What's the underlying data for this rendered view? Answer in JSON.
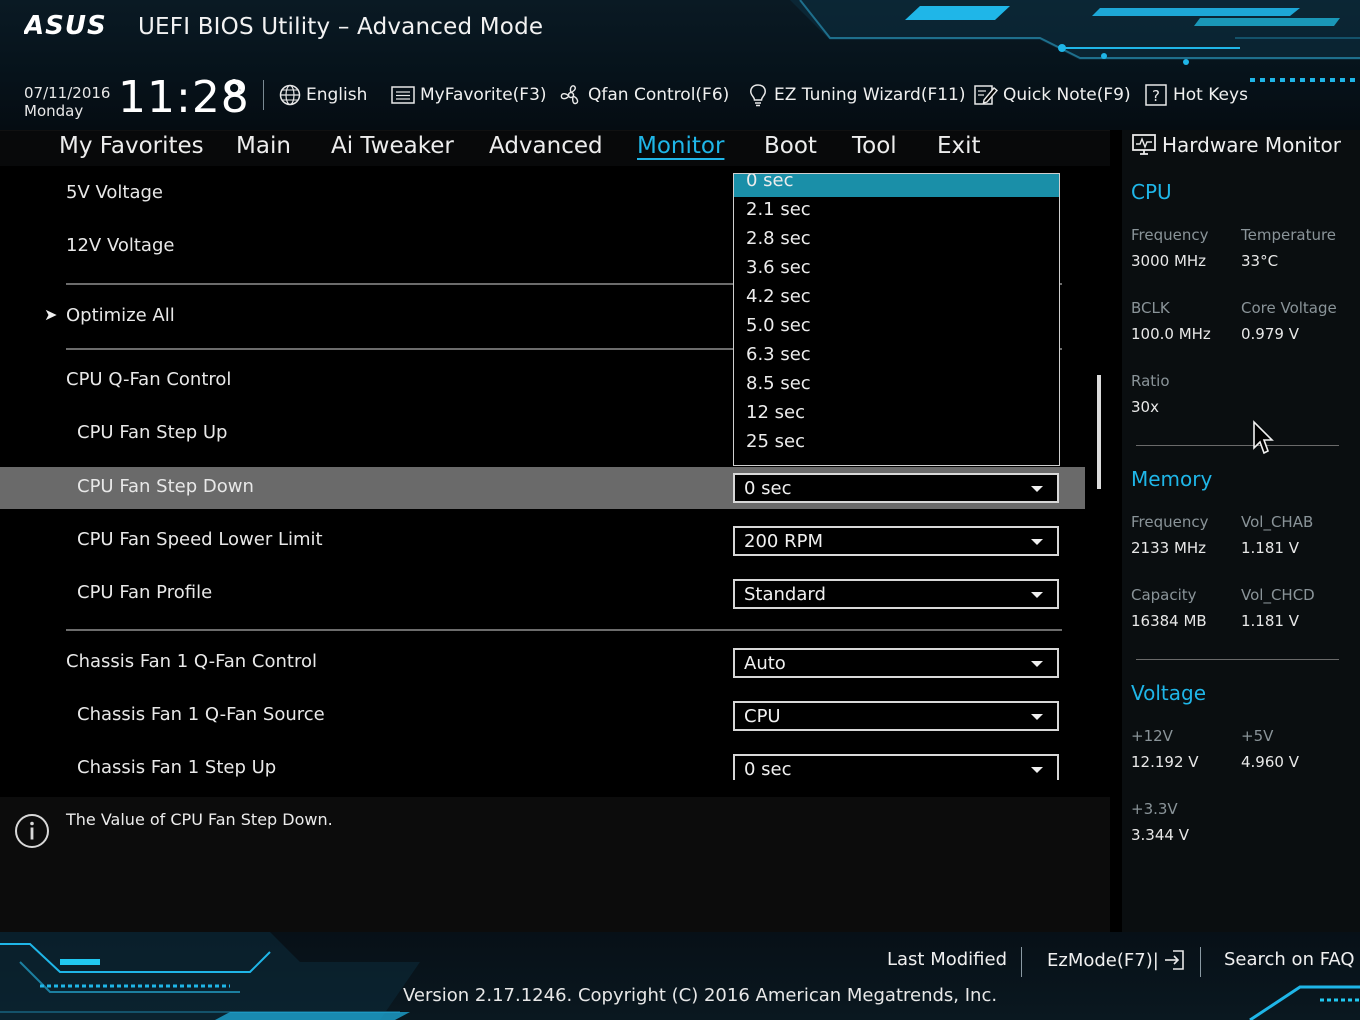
{
  "header": {
    "logo_text": "ASUS",
    "title": "UEFI BIOS Utility – Advanced Mode",
    "date": "07/11/2016",
    "day": "Monday",
    "time": "11:28",
    "language": "English",
    "buttons": {
      "myfavorite": "MyFavorite(F3)",
      "qfan": "Qfan Control(F6)",
      "ez_tuning": "EZ Tuning Wizard(F11)",
      "quick_note": "Quick Note(F9)",
      "hot_keys": "Hot Keys"
    }
  },
  "tabs": [
    "My Favorites",
    "Main",
    "Ai Tweaker",
    "Advanced",
    "Monitor",
    "Boot",
    "Tool",
    "Exit"
  ],
  "active_tab": "Monitor",
  "settings": {
    "v5": "5V Voltage",
    "v12": "12V Voltage",
    "optimize_all": "Optimize All",
    "cpu_qfan_control": "CPU Q-Fan Control",
    "cpu_fan_step_up": "CPU Fan Step Up",
    "cpu_fan_step_down": {
      "label": "CPU Fan Step Down",
      "value": "0 sec"
    },
    "cpu_fan_speed_lower_limit": {
      "label": "CPU Fan Speed Lower Limit",
      "value": "200 RPM"
    },
    "cpu_fan_profile": {
      "label": "CPU Fan Profile",
      "value": "Standard"
    },
    "chassis_fan1_qfan_control": {
      "label": "Chassis Fan 1 Q-Fan Control",
      "value": "Auto"
    },
    "chassis_fan1_qfan_source": {
      "label": "Chassis Fan 1 Q-Fan Source",
      "value": "CPU"
    },
    "chassis_fan1_step_up": {
      "label": "Chassis Fan 1 Step Up",
      "value": "0 sec"
    }
  },
  "dropdown_options": [
    "0 sec",
    "2.1 sec",
    "2.8 sec",
    "3.6 sec",
    "4.2 sec",
    "5.0 sec",
    "6.3 sec",
    "8.5 sec",
    "12 sec",
    "25 sec"
  ],
  "dropdown_selected": "0 sec",
  "help_text": "The Value of CPU Fan Step Down.",
  "hardware_monitor": {
    "title": "Hardware Monitor",
    "cpu": {
      "heading": "CPU",
      "frequency_label": "Frequency",
      "frequency": "3000 MHz",
      "temperature_label": "Temperature",
      "temperature": "33°C",
      "bclk_label": "BCLK",
      "bclk": "100.0 MHz",
      "core_voltage_label": "Core Voltage",
      "core_voltage": "0.979 V",
      "ratio_label": "Ratio",
      "ratio": "30x"
    },
    "memory": {
      "heading": "Memory",
      "frequency_label": "Frequency",
      "frequency": "2133 MHz",
      "vol_chab_label": "Vol_CHAB",
      "vol_chab": "1.181 V",
      "capacity_label": "Capacity",
      "capacity": "16384 MB",
      "vol_chcd_label": "Vol_CHCD",
      "vol_chcd": "1.181 V"
    },
    "voltage": {
      "heading": "Voltage",
      "v12_label": "+12V",
      "v12": "12.192 V",
      "v5_label": "+5V",
      "v5": "4.960 V",
      "v33_label": "+3.3V",
      "v33": "3.344 V"
    }
  },
  "footer": {
    "last_modified": "Last Modified",
    "ezmode": "EzMode(F7)|",
    "search_faq": "Search on FAQ",
    "copyright": "Version 2.17.1246. Copyright (C) 2016 American Megatrends, Inc."
  },
  "colors": {
    "accent": "#1fb6e8",
    "selected_row": "#6a6a6a",
    "highlight_option": "#1a8fa8"
  }
}
